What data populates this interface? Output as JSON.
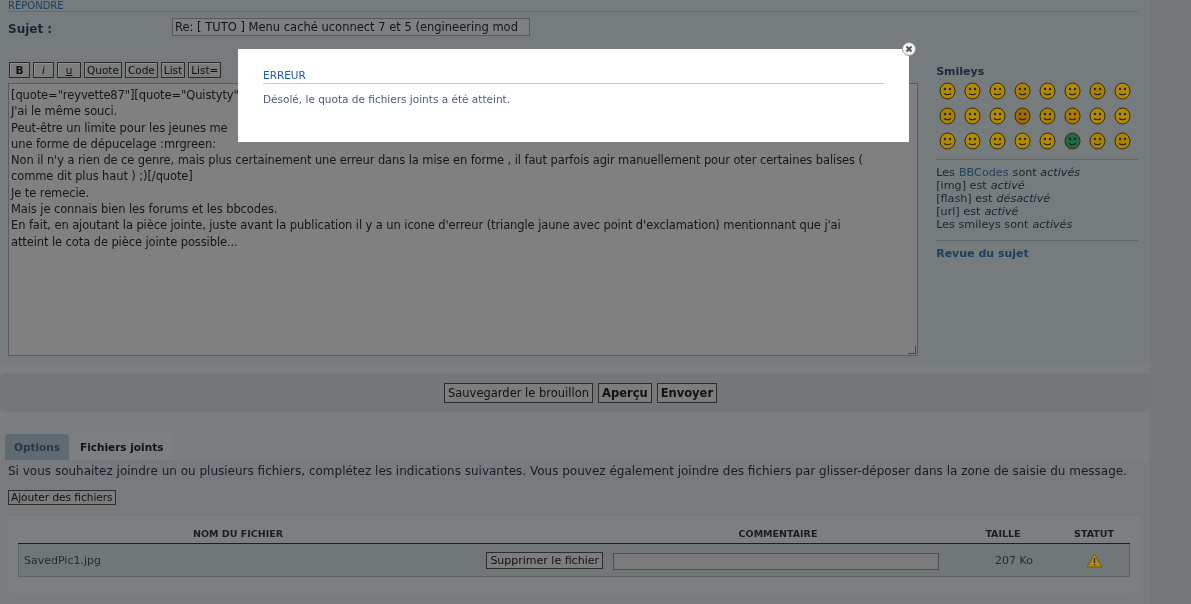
{
  "section_title": "RÉPONDRE",
  "subject": {
    "label": "Sujet :",
    "value": "Re: [ TUTO ] Menu caché uconnect 7 et 5 (engineering mod"
  },
  "toolbar": [
    {
      "label": "B",
      "kind": "bold"
    },
    {
      "label": "i",
      "kind": "italic"
    },
    {
      "label": "u",
      "kind": "underline"
    },
    {
      "label": "Quote",
      "kind": "plain"
    },
    {
      "label": "Code",
      "kind": "plain"
    },
    {
      "label": "List",
      "kind": "plain"
    },
    {
      "label": "List=",
      "kind": "plain"
    }
  ],
  "message_lines": [
    "[quote=\"reyvette87\"][quote=\"Quistyty\"",
    "J'ai le même souci.",
    "Peut-être un limite pour les jeunes me",
    "une forme de dépucelage  :mrgreen:",
    "Non il n'y a rien de ce genre, mais plus certainement une erreur dans la mise en forme , il faut parfois agir manuellement pour oter certaines balises (",
    "comme dit plus haut )    ;)[/quote]",
    "Je te remecie.",
    "Mais je connais bien les forums et les bbcodes.",
    "En fait, en ajoutant la pièce jointe, juste avant la publication il y a un icone d'erreur (triangle jaune avec point d'exclamation) mentionnant que j'ai",
    "atteint le cota de pièce jointe possible..."
  ],
  "sidebar": {
    "smileys_title": "Smileys",
    "info": [
      {
        "kind": "link",
        "before": "Les",
        "link": "BBCodes",
        "after": "sont *activés*"
      },
      {
        "kind": "text",
        "text": "[img] est *activé*"
      },
      {
        "kind": "text",
        "text": "[flash] est *désactivé*"
      },
      {
        "kind": "text",
        "text": "[url] est *activé*"
      },
      {
        "kind": "text",
        "text": "Les smileys sont *activés*"
      }
    ],
    "review_link": "Revue du sujet"
  },
  "actions": [
    {
      "label": "Sauvegarder le brouillon",
      "primary": false
    },
    {
      "label": "Aperçu",
      "primary": true
    },
    {
      "label": "Envoyer",
      "primary": true
    }
  ],
  "tabs": [
    {
      "label": "Options",
      "selected": false
    },
    {
      "label": "Fichiers joints",
      "selected": true
    }
  ],
  "attachments": {
    "intro": "Si vous souhaitez joindre un ou plusieurs fichiers, complétez les indications suivantes. Vous pouvez également joindre des fichiers par glisser-déposer dans la zone de saisie du message.",
    "add_button": "Ajouter des fichiers",
    "columns": [
      "NOM DU FICHIER",
      "COMMENTAIRE",
      "TAILLE",
      "STATUT"
    ],
    "rows": [
      {
        "name": "SavedPic1.jpg",
        "delete_button": "Supprimer le fichier",
        "size": "207 Ko",
        "warning": true
      }
    ]
  },
  "dialog": {
    "title": "ERREUR",
    "message": "Désolé, le quota de fichiers joints a été atteint."
  }
}
